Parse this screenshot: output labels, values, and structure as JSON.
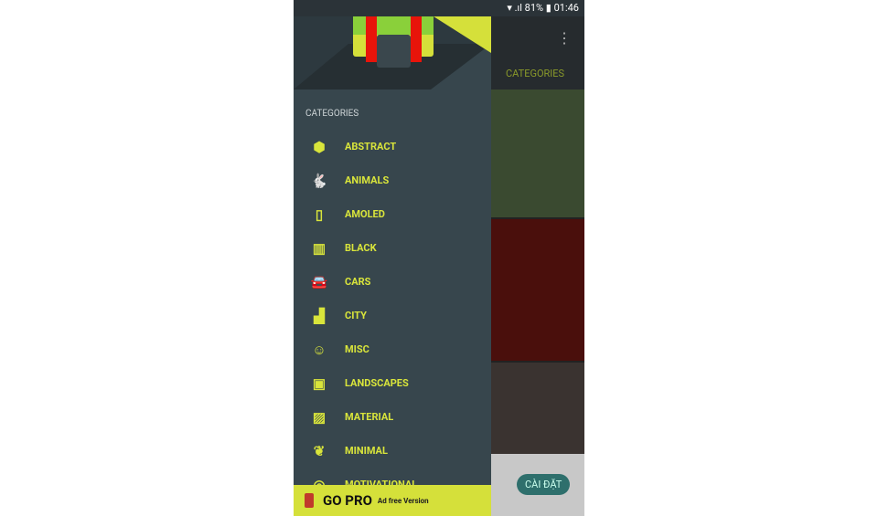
{
  "status": {
    "battery": "81%",
    "time": "01:46"
  },
  "appbar": {
    "tab": "CATEGORIES",
    "menu_icon": "more-vert-icon"
  },
  "drawer": {
    "section": "CATEGORIES",
    "items": [
      {
        "label": "ABSTRACT",
        "icon": "cube-icon",
        "glyph": "⬢"
      },
      {
        "label": "ANIMALS",
        "icon": "rabbit-icon",
        "glyph": "🐇"
      },
      {
        "label": "AMOLED",
        "icon": "phone-icon",
        "glyph": "▯"
      },
      {
        "label": "BLACK",
        "icon": "film-icon",
        "glyph": "▥"
      },
      {
        "label": "CARS",
        "icon": "car-icon",
        "glyph": "🚘"
      },
      {
        "label": "CITY",
        "icon": "city-icon",
        "glyph": "▟"
      },
      {
        "label": "MISC",
        "icon": "smiley-icon",
        "glyph": "☺"
      },
      {
        "label": "LANDSCAPES",
        "icon": "image-icon",
        "glyph": "▣"
      },
      {
        "label": "MATERIAL",
        "icon": "stripes-icon",
        "glyph": "▨"
      },
      {
        "label": "MINIMAL",
        "icon": "leaf-icon",
        "glyph": "❦"
      },
      {
        "label": "MOTIVATIONAL",
        "icon": "target-icon",
        "glyph": "◎"
      }
    ]
  },
  "gopro": {
    "title": "GO PRO",
    "subtitle": "Ad free Version"
  },
  "ad": {
    "install": "CÀI ĐẶT"
  }
}
